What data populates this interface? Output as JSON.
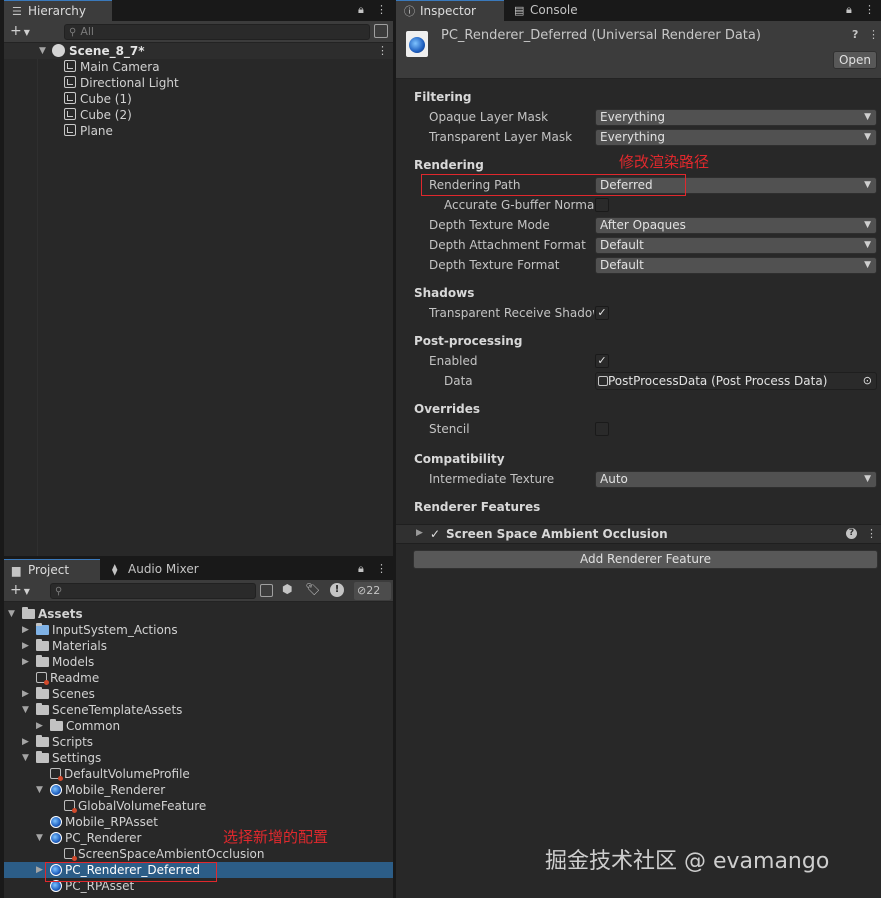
{
  "hierarchy": {
    "tab": "Hierarchy",
    "search_placeholder": "All",
    "scene": "Scene_8_7*",
    "items": [
      "Main Camera",
      "Directional Light",
      "Cube (1)",
      "Cube (2)",
      "Plane"
    ]
  },
  "project": {
    "tab": "Project",
    "tab2": "Audio Mixer",
    "hidden_count": "22",
    "tree": [
      {
        "label": "Assets",
        "indent": 0,
        "icon": "folder",
        "arrow": "open",
        "bold": true
      },
      {
        "label": "InputSystem_Actions",
        "indent": 1,
        "icon": "input",
        "arrow": "closed"
      },
      {
        "label": "Materials",
        "indent": 1,
        "icon": "folder",
        "arrow": "closed"
      },
      {
        "label": "Models",
        "indent": 1,
        "icon": "folder",
        "arrow": "closed"
      },
      {
        "label": "Readme",
        "indent": 1,
        "icon": "small",
        "arrow": "none"
      },
      {
        "label": "Scenes",
        "indent": 1,
        "icon": "folder",
        "arrow": "closed"
      },
      {
        "label": "SceneTemplateAssets",
        "indent": 1,
        "icon": "folder",
        "arrow": "open"
      },
      {
        "label": "Common",
        "indent": 2,
        "icon": "folder",
        "arrow": "closed"
      },
      {
        "label": "Scripts",
        "indent": 1,
        "icon": "folder",
        "arrow": "closed"
      },
      {
        "label": "Settings",
        "indent": 1,
        "icon": "folder",
        "arrow": "open"
      },
      {
        "label": "DefaultVolumeProfile",
        "indent": 2,
        "icon": "small",
        "arrow": "none"
      },
      {
        "label": "Mobile_Renderer",
        "indent": 2,
        "icon": "blue",
        "arrow": "open"
      },
      {
        "label": "GlobalVolumeFeature",
        "indent": 3,
        "icon": "small",
        "arrow": "none"
      },
      {
        "label": "Mobile_RPAsset",
        "indent": 2,
        "icon": "blue",
        "arrow": "none"
      },
      {
        "label": "PC_Renderer",
        "indent": 2,
        "icon": "blue",
        "arrow": "open"
      },
      {
        "label": "ScreenSpaceAmbientOcclusion",
        "indent": 3,
        "icon": "small",
        "arrow": "none"
      },
      {
        "label": "PC_Renderer_Deferred",
        "indent": 2,
        "icon": "blue",
        "arrow": "closed",
        "selected": true
      },
      {
        "label": "PC_RPAsset",
        "indent": 2,
        "icon": "blue",
        "arrow": "none"
      }
    ]
  },
  "inspector": {
    "tab": "Inspector",
    "tab2": "Console",
    "title": "PC_Renderer_Deferred (Universal Renderer Data)",
    "open_button": "Open",
    "filtering": {
      "heading": "Filtering",
      "opaque_label": "Opaque Layer Mask",
      "opaque_value": "Everything",
      "transparent_label": "Transparent Layer Mask",
      "transparent_value": "Everything"
    },
    "rendering": {
      "heading": "Rendering",
      "path_label": "Rendering Path",
      "path_value": "Deferred",
      "gbuffer_label": "Accurate G-buffer Normals",
      "depth_mode_label": "Depth Texture Mode",
      "depth_mode_value": "After Opaques",
      "depth_attach_label": "Depth Attachment Format",
      "depth_attach_value": "Default",
      "depth_tex_label": "Depth Texture Format",
      "depth_tex_value": "Default"
    },
    "shadows": {
      "heading": "Shadows",
      "receive_label": "Transparent Receive Shadows",
      "receive_checked": true
    },
    "postprocessing": {
      "heading": "Post-processing",
      "enabled_label": "Enabled",
      "enabled_checked": true,
      "data_label": "Data",
      "data_value": "PostProcessData (Post Process Data)"
    },
    "overrides": {
      "heading": "Overrides",
      "stencil_label": "Stencil",
      "stencil_checked": false
    },
    "compatibility": {
      "heading": "Compatibility",
      "intermediate_label": "Intermediate Texture",
      "intermediate_value": "Auto"
    },
    "features": {
      "heading": "Renderer Features",
      "feature_name": "Screen Space Ambient Occlusion",
      "add_button": "Add Renderer Feature"
    }
  },
  "annotations": {
    "rendering_path_note": "修改渲染路径",
    "new_config_note": "选择新增的配置"
  },
  "watermark": "掘金技术社区 @ evamango",
  "colors": {
    "accent": "#3a79bb",
    "selection": "#2c5d87",
    "annotation_red": "#e0282d"
  }
}
